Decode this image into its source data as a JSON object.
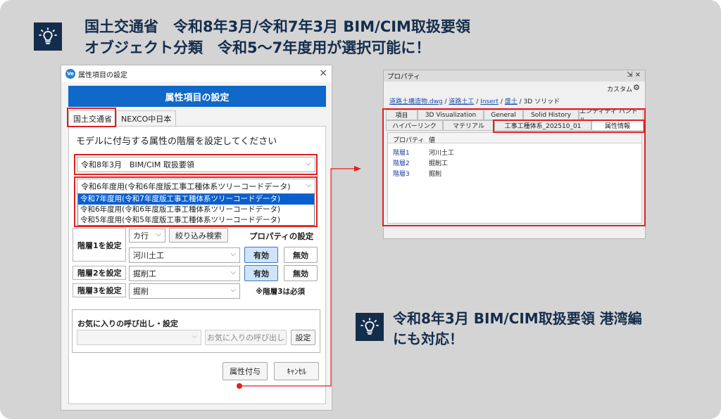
{
  "headline": {
    "line1": "国土交通省　令和8年3月/令和7年3月 BIM/CIM取扱要領",
    "line2": "オブジェクト分類　令和5～7年度用が選択可能に！"
  },
  "note": {
    "line1": "令和8年3月 BIM/CIM取扱要領 港湾編",
    "line2": "にも対応！"
  },
  "dialog": {
    "app_icon": "Ve",
    "title": "属性項目の設定",
    "close": "×",
    "header": "属性項目の設定",
    "tabs": [
      "国土交通省",
      "NEXCO中日本"
    ],
    "instruction": "モデルに付与する属性の階層を設定してください",
    "guideline_select": "令和8年3月　BIM/CIM 取扱要領",
    "version_select": "令和6年度用(令和6年度版工事工種体系ツリーコードデータ)",
    "version_options": [
      "令和7年度用(令和7年度版工事工種体系ツリーコードデータ)",
      "令和6年度用(令和6年度版工事工種体系ツリーコードデータ)",
      "令和5年度用(令和5年度版工事工種体系ツリーコードデータ)"
    ],
    "kana_select": "カ行",
    "filter_button": "絞り込み検索",
    "property_setting_label": "プロパティの設定",
    "levels": [
      {
        "label": "階層1を設定",
        "value": "河川土工",
        "enable": "有効",
        "disable": "無効"
      },
      {
        "label": "階層2を設定",
        "value": "掘削工",
        "enable": "有効",
        "disable": "無効"
      },
      {
        "label": "階層3を設定",
        "value": "掘削"
      }
    ],
    "level3_required": "※階層3は必須",
    "favorites": {
      "title": "お気に入りの呼び出し・設定",
      "select_value": "",
      "call_button": "お気に入りの呼び出し",
      "set_button": "設定"
    },
    "apply_button": "属性付与",
    "cancel_button": "ｷｬﾝｾﾙ"
  },
  "properties": {
    "title": "プロパティ",
    "controls": "⇲ ×",
    "custom_label": "カスタム",
    "breadcrumb": {
      "links": [
        "道路土構造物.dwg",
        "道路土工",
        "Insert",
        "盛土"
      ],
      "separator": " / ",
      "last": "3D ソリッド"
    },
    "tabs_row1": [
      "項目",
      "3D Visualization",
      "General",
      "Solid History",
      "エンティティ ハンドル"
    ],
    "tabs_row2": [
      "ハイパーリンク",
      "マテリアル",
      "工事工種体系_202510_01",
      "属性情報"
    ],
    "grid_headers": [
      "プロパティ",
      "値"
    ],
    "rows": [
      {
        "key": "階層1",
        "value": "河川土工"
      },
      {
        "key": "階層2",
        "value": "掘削工"
      },
      {
        "key": "階層3",
        "value": "掘削"
      }
    ]
  },
  "colors": {
    "navy": "#142d4c",
    "header_blue": "#1068c8",
    "highlight_red": "#e02020",
    "selection_blue": "#0a5fd0"
  }
}
